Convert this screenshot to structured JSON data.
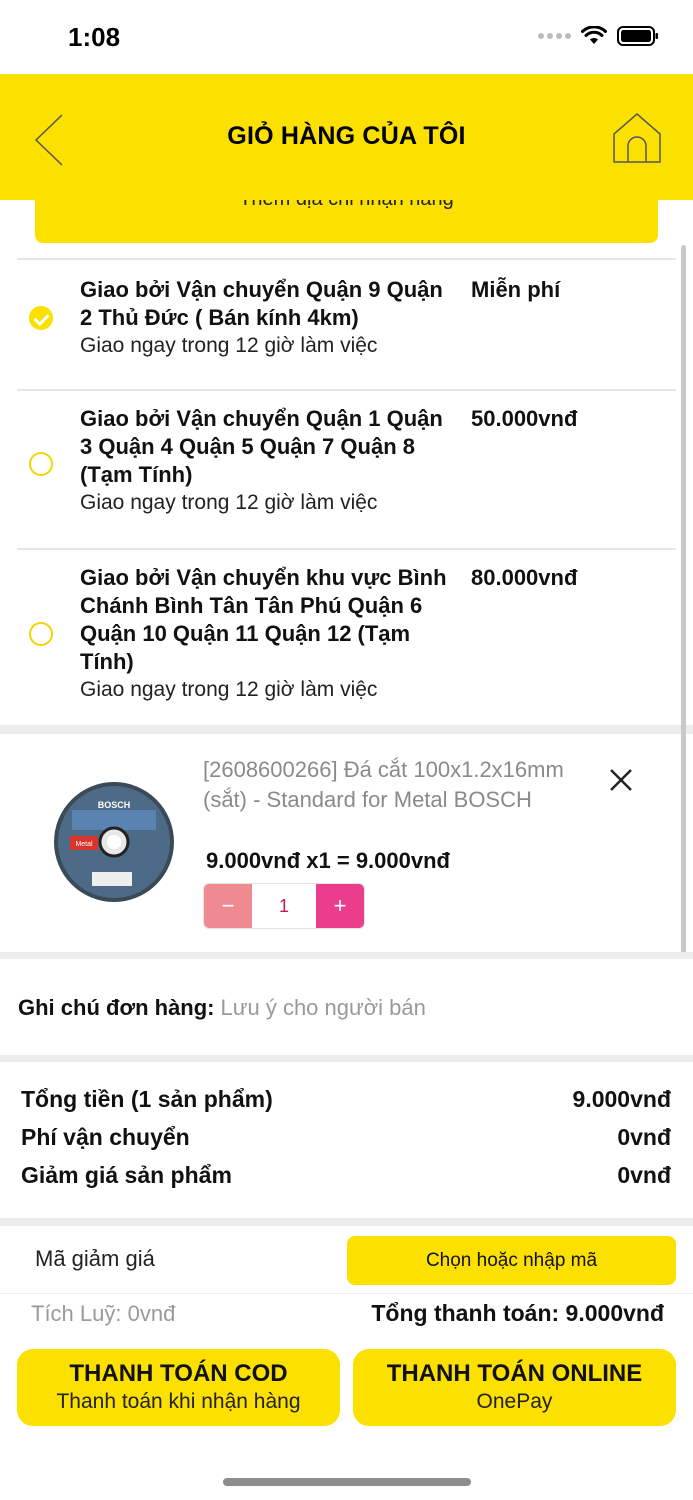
{
  "status_bar": {
    "time": "1:08"
  },
  "header": {
    "title": "GIỎ HÀNG CỦA TÔI"
  },
  "address_button": {
    "label": "Thêm địa chỉ nhận hàng"
  },
  "shipping_options": [
    {
      "title": "Giao bởi Vận chuyển Quận 9 Quận 2 Thủ Đức ( Bán kính 4km)",
      "title_lines": [
        "Giao bởi Vận chuyển Quận 9 Quận",
        "2 Thủ Đức ( Bán kính 4km)"
      ],
      "price": "Miễn phí",
      "subtitle": "Giao ngay trong 12 giờ làm việc",
      "selected": true
    },
    {
      "title": "Giao bởi Vận chuyển Quận 1 Quận 3 Quận 4 Quận 5 Quận 7 Quận 8 (Tạm Tính)",
      "title_lines": [
        "Giao bởi Vận chuyển Quận 1 Quận",
        "3 Quận 4 Quận 5 Quận 7 Quận 8",
        "(Tạm Tính)"
      ],
      "price": "50.000vnđ",
      "subtitle": "Giao ngay trong 12 giờ làm việc",
      "selected": false
    },
    {
      "title": "Giao bởi Vận chuyển khu vực Bình Chánh Bình Tân Tân Phú Quận 6 Quận 10 Quận 11 Quận 12 (Tạm Tính)",
      "title_lines": [
        "Giao bởi Vận chuyển khu vực Bình",
        "Chánh Bình Tân Tân Phú Quận 6",
        "Quận 10 Quận 11 Quận 12 (Tạm",
        "Tính)"
      ],
      "price": "80.000vnđ",
      "subtitle": "Giao ngay trong 12 giờ làm việc",
      "selected": false
    }
  ],
  "cart_item": {
    "name": "[2608600266] Đá cắt 100x1.2x16mm (sắt) - Standard for Metal BOSCH",
    "price_line": "9.000vnđ x1 = 9.000vnđ",
    "quantity": "1",
    "minus": "−",
    "plus": "+",
    "image_brand": "BOSCH",
    "image_tag": "Metal"
  },
  "order_note": {
    "label": "Ghi chú đơn hàng:",
    "placeholder": "Lưu ý cho người bán"
  },
  "summary": {
    "subtotal_label": "Tổng tiền (1 sản phẩm)",
    "subtotal_value": "9.000vnđ",
    "shipping_label": "Phí vận chuyển",
    "shipping_value": "0vnđ",
    "discount_label": "Giảm giá sản phẩm",
    "discount_value": "0vnđ"
  },
  "coupon": {
    "label": "Mã giảm giá",
    "button": "Chọn hoặc nhập mã"
  },
  "points": "Tích Luỹ: 0vnđ",
  "grand_total": "Tổng thanh toán: 9.000vnđ",
  "payment": {
    "cod_title": "THANH TOÁN COD",
    "cod_sub": "Thanh toán khi nhận hàng",
    "online_title": "THANH TOÁN ONLINE",
    "online_sub": "OnePay"
  },
  "colors": {
    "brand_yellow": "#fbe000",
    "minus_pink": "#f08a91",
    "plus_pink": "#ec3c8c"
  }
}
